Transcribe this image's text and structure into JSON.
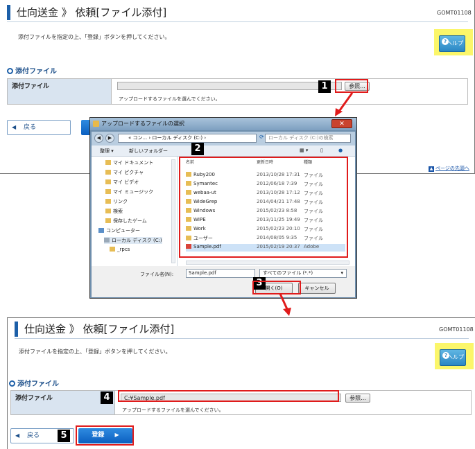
{
  "top": {
    "title": "仕向送金 》 依頼[ファイル添付]",
    "screen_code": "GOMT01108",
    "instruction": "添付ファイルを指定の上、「登録」ボタンを押してください。",
    "help_label": "ヘルプ",
    "section_title": "添付ファイル",
    "row_label": "添付ファイル",
    "file_value": "",
    "browse_label": "参照...",
    "hint": "アップロードするファイルを選んでください。",
    "back_label": "戻る",
    "page_top_link": "ページの先頭へ"
  },
  "dialog": {
    "title": "アップロードするファイルの選択",
    "address": "« コン... › ローカル ディスク (C:) ›",
    "search_placeholder": "ローカル ディスク (C:)の検索",
    "toolbar": {
      "organize": "整理 ▾",
      "new_folder": "新しいフォルダー"
    },
    "nav_items": [
      {
        "label": "マイ ドキュメント",
        "icon": "folder-icon"
      },
      {
        "label": "マイ ピクチャ",
        "icon": "folder-icon"
      },
      {
        "label": "マイ ビデオ",
        "icon": "folder-icon"
      },
      {
        "label": "マイ ミュージック",
        "icon": "folder-icon"
      },
      {
        "label": "リンク",
        "icon": "folder-icon"
      },
      {
        "label": "検索",
        "icon": "folder-icon"
      },
      {
        "label": "保存したゲーム",
        "icon": "folder-icon"
      },
      {
        "label": "コンピューター",
        "icon": "computer-icon"
      },
      {
        "label": "ローカル ディスク (C:)",
        "icon": "drive-icon"
      },
      {
        "label": "_rpcs",
        "icon": "folder-icon"
      }
    ],
    "columns": {
      "name": "名前",
      "date": "更新日時",
      "type": "種類"
    },
    "files": [
      {
        "name": "Ruby200",
        "date": "2013/10/28 17:31",
        "type": "ファイル"
      },
      {
        "name": "Symantec",
        "date": "2012/06/18 7:39",
        "type": "ファイル"
      },
      {
        "name": "webaa-ut",
        "date": "2013/10/28 17:12",
        "type": "ファイル"
      },
      {
        "name": "WideGrep",
        "date": "2014/04/21 17:48",
        "type": "ファイル"
      },
      {
        "name": "Windows",
        "date": "2015/02/23 8:58",
        "type": "ファイル"
      },
      {
        "name": "WIPE",
        "date": "2013/11/25 19:49",
        "type": "ファイル"
      },
      {
        "name": "Work",
        "date": "2015/02/23 20:10",
        "type": "ファイル"
      },
      {
        "name": "ユーザー",
        "date": "2014/08/05 9:35",
        "type": "ファイル"
      },
      {
        "name": "Sample.pdf",
        "date": "2015/02/19 20:37",
        "type": "Adobe"
      }
    ],
    "filename_label": "ファイル名(N):",
    "filename_value": "Sample.pdf",
    "filter_value": "すべてのファイル (*.*)",
    "open_label": "開く(O)",
    "cancel_label": "キャンセル"
  },
  "bottom": {
    "title": "仕向送金 》 依頼[ファイル添付]",
    "screen_code": "GOMT01108",
    "instruction": "添付ファイルを指定の上、「登録」ボタンを押してください。",
    "help_label": "ヘルプ",
    "section_title": "添付ファイル",
    "row_label": "添付ファイル",
    "file_value": "C:¥Sample.pdf",
    "browse_label": "参照...",
    "hint": "アップロードするファイルを選んでください。",
    "back_label": "戻る",
    "register_label": "登録"
  },
  "steps": [
    "1",
    "2",
    "3",
    "4",
    "5"
  ],
  "colors": {
    "highlight": "#e01b1b",
    "help_bg": "#fbf66a",
    "accent": "#1c5fa8"
  }
}
